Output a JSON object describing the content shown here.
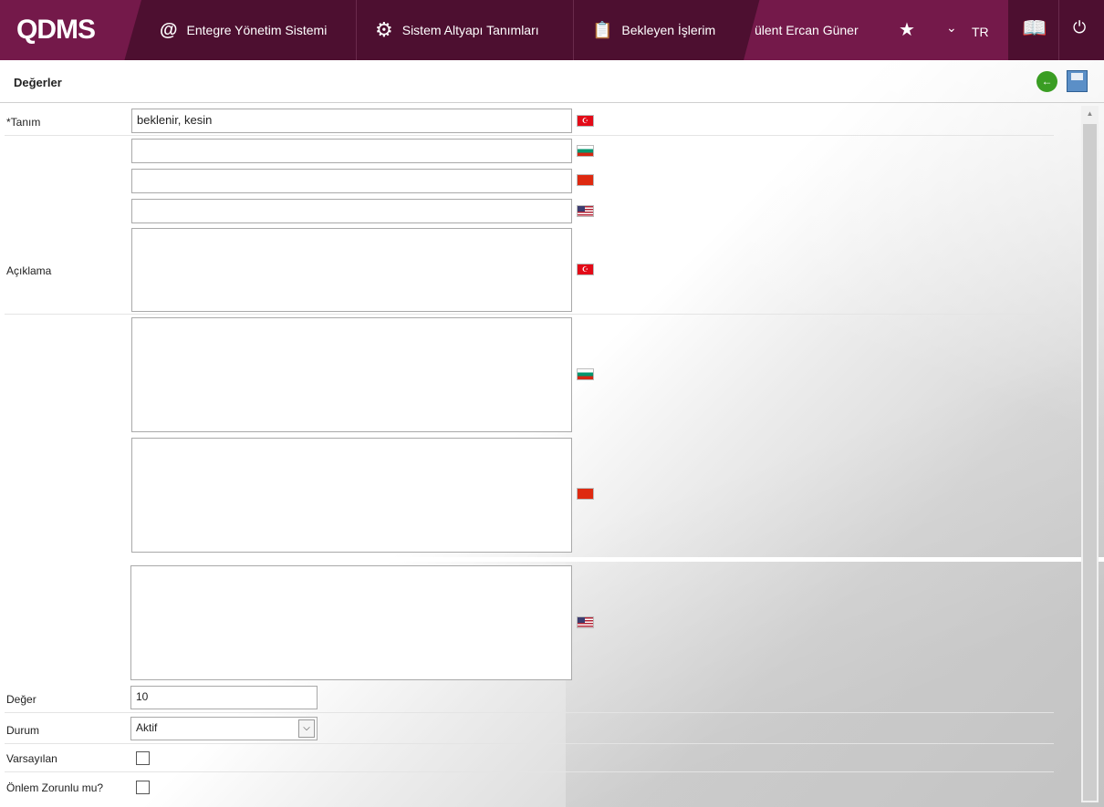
{
  "nav": {
    "logo": "QDMS",
    "items": [
      {
        "label": "Entegre Yönetim Sistemi",
        "icon": "q-icon"
      },
      {
        "label": "Sistem Altyapı Tanımları",
        "icon": "gear-icon"
      },
      {
        "label": "Bekleyen İşlerim",
        "icon": "clipboard-icon"
      }
    ],
    "user": "ülent Ercan Güner",
    "lang": "TR"
  },
  "page": {
    "title": "Değerler"
  },
  "form": {
    "tanim_label": "*Tanım",
    "tanim_tr": "beklenir, kesin",
    "tanim_bg": "",
    "tanim_cn": "",
    "tanim_en": "",
    "aciklama_label": "Açıklama",
    "deger_label": "Değer",
    "deger_value": "10",
    "durum_label": "Durum",
    "durum_value": "Aktif",
    "varsayilan_label": "Varsayılan",
    "onlem_label": "Önlem Zorunlu mu?"
  },
  "colors": {
    "nav_dark": "#4d0f30",
    "nav_accent": "#74194a"
  }
}
